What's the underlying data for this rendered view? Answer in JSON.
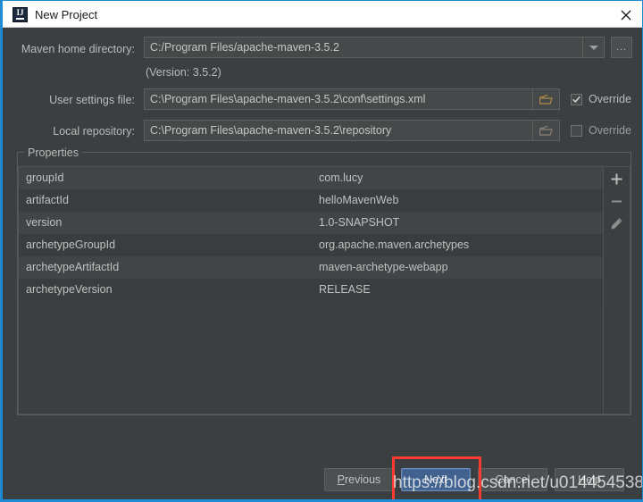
{
  "window": {
    "title": "New Project",
    "app_icon": "intellij-idea-icon",
    "close_icon": "close-icon",
    "accent_border": "#1f8ad4",
    "background": "#3c3f41"
  },
  "form": {
    "maven_home": {
      "label": "Maven home directory:",
      "value": "C:/Program Files/apache-maven-3.5.2",
      "dropdown_icon": "chevron-down-icon",
      "browse_label": "...",
      "version_note": "(Version: 3.5.2)"
    },
    "user_settings": {
      "label": "User settings file:",
      "value": "C:\\Program Files\\apache-maven-3.5.2\\conf\\settings.xml",
      "folder_icon": "folder-icon",
      "override_label": "Override",
      "override_checked": true
    },
    "local_repository": {
      "label": "Local repository:",
      "value": "C:\\Program Files\\apache-maven-3.5.2\\repository",
      "folder_icon": "folder-icon",
      "override_label": "Override",
      "override_checked": false
    }
  },
  "properties": {
    "group_title": "Properties",
    "rows": [
      {
        "key": "groupId",
        "value": "com.lucy"
      },
      {
        "key": "artifactId",
        "value": "helloMavenWeb"
      },
      {
        "key": "version",
        "value": "1.0-SNAPSHOT"
      },
      {
        "key": "archetypeGroupId",
        "value": "org.apache.maven.archetypes"
      },
      {
        "key": "archetypeArtifactId",
        "value": "maven-archetype-webapp"
      },
      {
        "key": "archetypeVersion",
        "value": "RELEASE"
      }
    ],
    "toolbar": {
      "add_icon": "plus-icon",
      "remove_icon": "minus-icon",
      "edit_icon": "pencil-icon"
    }
  },
  "footer": {
    "previous": {
      "label": "Previous",
      "mnemonic": "P",
      "rest": "revious"
    },
    "next": {
      "label": "Next",
      "highlighted": true,
      "color": "#41618e"
    },
    "cancel": {
      "label": "Cancel"
    },
    "help": {
      "label": "Help"
    }
  },
  "annotation": {
    "color": "#fd3c2d",
    "target": "next-button"
  },
  "watermark": {
    "text": "https://blog.csdn.net/u014454538"
  }
}
